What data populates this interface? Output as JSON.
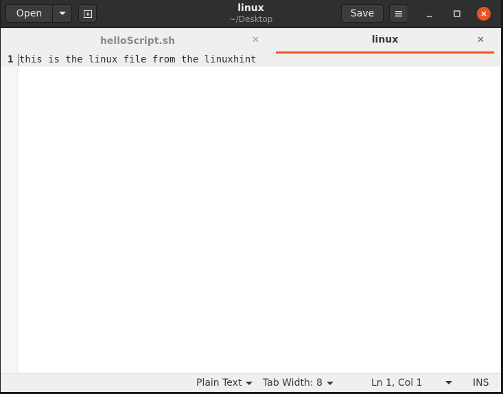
{
  "header": {
    "open_label": "Open",
    "save_label": "Save",
    "title": "linux",
    "subtitle": "~/Desktop"
  },
  "tabs": [
    {
      "label": "helloScript.sh",
      "active": false
    },
    {
      "label": "linux",
      "active": true
    }
  ],
  "editor": {
    "lines": [
      {
        "number": "1",
        "text": "this is the linux file from the linuxhint"
      }
    ]
  },
  "status": {
    "language": "Plain Text",
    "tab_width": "Tab Width: 8",
    "position": "Ln 1, Col 1",
    "mode": "INS"
  },
  "colors": {
    "accent": "#e95420",
    "headerbar": "#2f2f2f"
  }
}
